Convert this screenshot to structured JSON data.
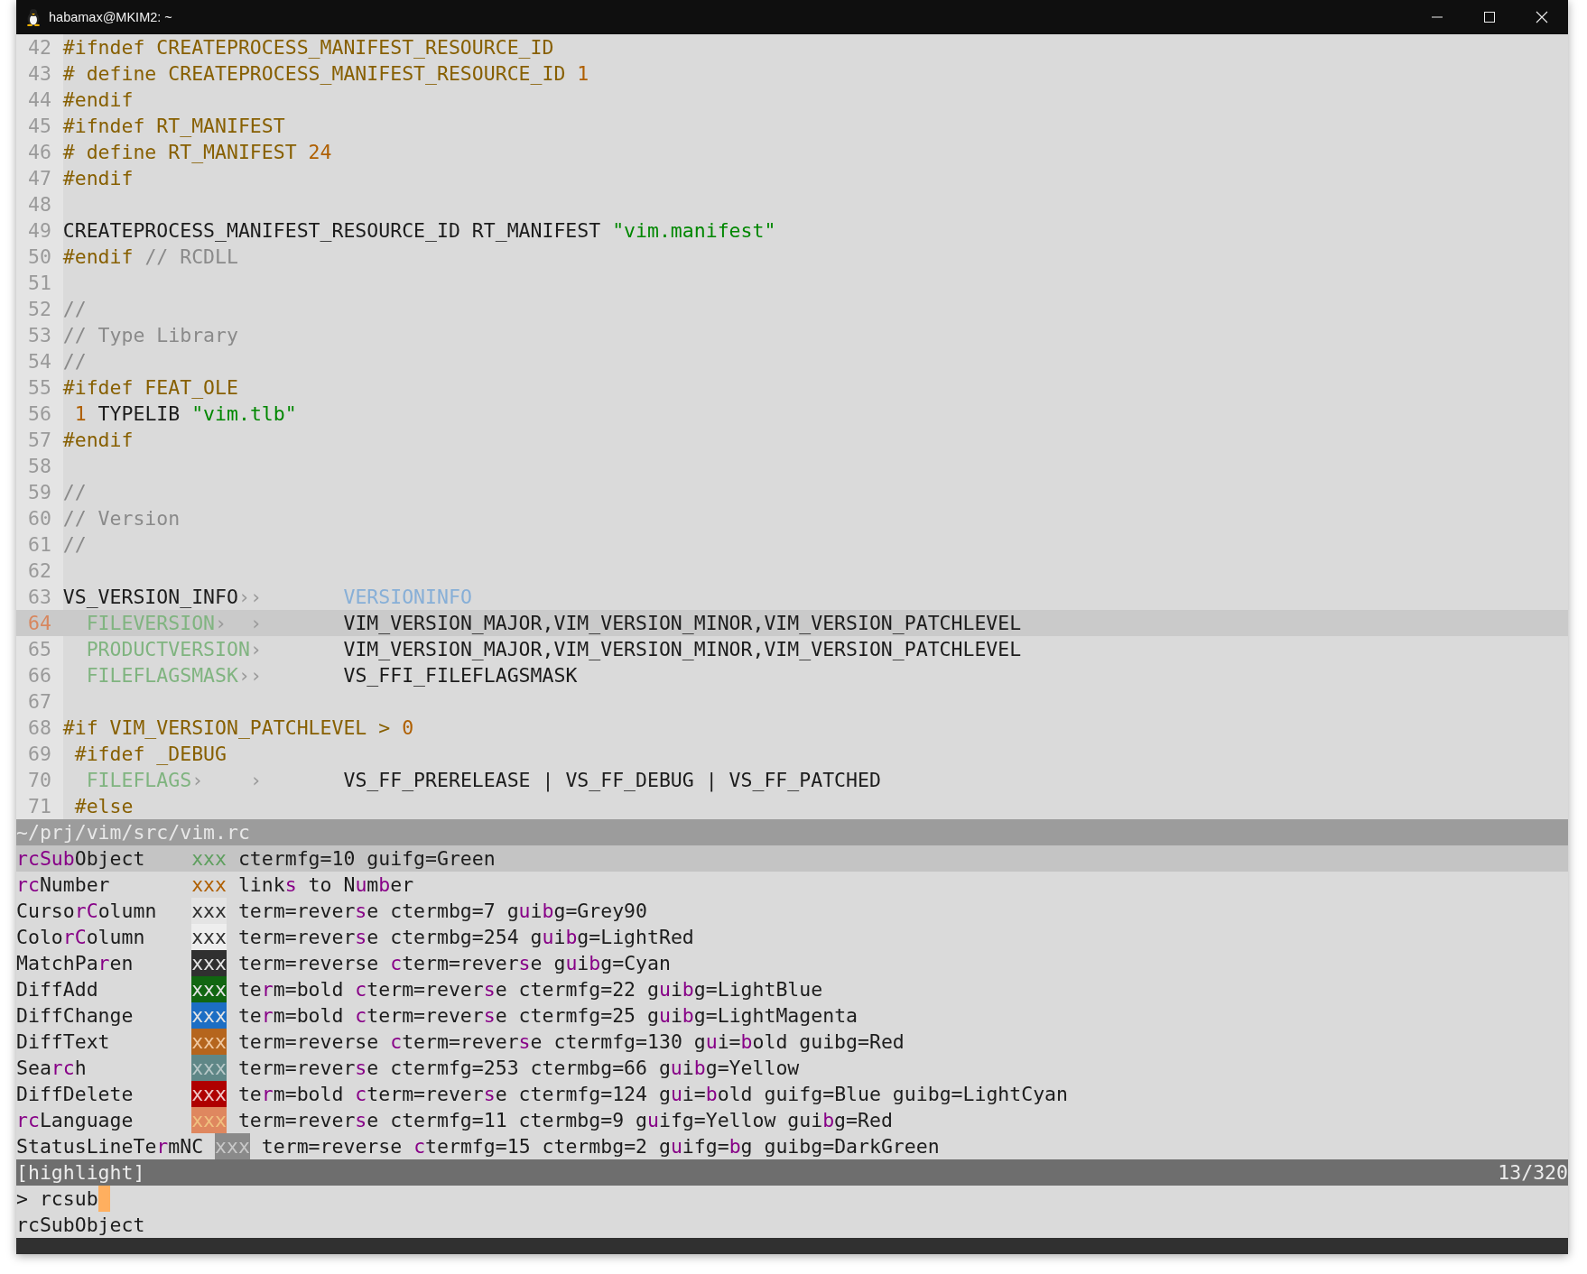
{
  "window": {
    "title": "habamax@MKIM2: ~"
  },
  "editor": {
    "lines": [
      {
        "number": "42",
        "current": false,
        "tokens": [
          {
            "text": "#ifndef CREATEPROCESS_MANIFEST_RESOURCE_ID",
            "kind": "keyword"
          }
        ]
      },
      {
        "number": "43",
        "current": false,
        "tokens": [
          {
            "text": "# define CREATEPROCESS_MANIFEST_RESOURCE_ID ",
            "kind": "keyword"
          },
          {
            "text": "1",
            "kind": "number"
          }
        ]
      },
      {
        "number": "44",
        "current": false,
        "tokens": [
          {
            "text": "#endif",
            "kind": "keyword"
          }
        ]
      },
      {
        "number": "45",
        "current": false,
        "tokens": [
          {
            "text": "#ifndef RT_MANIFEST",
            "kind": "keyword"
          }
        ]
      },
      {
        "number": "46",
        "current": false,
        "tokens": [
          {
            "text": "# define RT_MANIFEST ",
            "kind": "keyword"
          },
          {
            "text": "24",
            "kind": "number"
          }
        ]
      },
      {
        "number": "47",
        "current": false,
        "tokens": [
          {
            "text": "#endif",
            "kind": "keyword"
          }
        ]
      },
      {
        "number": "48",
        "current": false
      },
      {
        "number": "49",
        "current": false,
        "tokens": [
          {
            "text": "CREATEPROCESS_MANIFEST_RESOURCE_ID RT_MANIFEST ",
            "kind": "normal"
          },
          {
            "text": "\"vim.manifest\"",
            "kind": "string"
          }
        ]
      },
      {
        "number": "50",
        "current": false,
        "tokens": [
          {
            "text": "#endif ",
            "kind": "keyword"
          },
          {
            "text": "// RCDLL",
            "kind": "comment"
          }
        ]
      },
      {
        "number": "51",
        "current": false
      },
      {
        "number": "52",
        "current": false,
        "tokens": [
          {
            "text": "//",
            "kind": "comment"
          }
        ]
      },
      {
        "number": "53",
        "current": false,
        "tokens": [
          {
            "text": "// Type Library",
            "kind": "comment"
          }
        ]
      },
      {
        "number": "54",
        "current": false,
        "tokens": [
          {
            "text": "//",
            "kind": "comment"
          }
        ]
      },
      {
        "number": "55",
        "current": false,
        "tokens": [
          {
            "text": "#ifdef FEAT_OLE",
            "kind": "keyword"
          }
        ]
      },
      {
        "number": "56",
        "current": false,
        "tokens": [
          {
            "text": " 1",
            "kind": "number"
          },
          {
            "text": " TYPELIB ",
            "kind": "normal"
          },
          {
            "text": "\"vim.tlb\"",
            "kind": "string"
          }
        ]
      },
      {
        "number": "57",
        "current": false,
        "tokens": [
          {
            "text": "#endif",
            "kind": "keyword"
          }
        ]
      },
      {
        "number": "58",
        "current": false
      },
      {
        "number": "59",
        "current": false,
        "tokens": [
          {
            "text": "//",
            "kind": "comment"
          }
        ]
      },
      {
        "number": "60",
        "current": false,
        "tokens": [
          {
            "text": "// Version",
            "kind": "comment"
          }
        ]
      },
      {
        "number": "61",
        "current": false,
        "tokens": [
          {
            "text": "//",
            "kind": "comment"
          }
        ]
      },
      {
        "number": "62",
        "current": false
      },
      {
        "number": "63",
        "current": false,
        "tokens": [
          {
            "text": "VS_VERSION_INFO",
            "kind": "normal"
          },
          {
            "text": "››       ",
            "kind": "tab"
          },
          {
            "text": "VERSIONINFO",
            "kind": "tag"
          }
        ]
      },
      {
        "number": "64",
        "current": true,
        "tokens": [
          {
            "text": "  FILEVERSION",
            "kind": "faint"
          },
          {
            "text": "›  ›       ",
            "kind": "tab"
          },
          {
            "text": "VIM_VERSION_MAJOR,VIM_VERSION_MINOR,VIM_VERSION_PATCHLEVEL",
            "kind": "normal"
          }
        ]
      },
      {
        "number": "65",
        "current": false,
        "tokens": [
          {
            "text": "  PRODUCTVERSION",
            "kind": "faint"
          },
          {
            "text": "›       ",
            "kind": "tab"
          },
          {
            "text": "VIM_VERSION_MAJOR,VIM_VERSION_MINOR,VIM_VERSION_PATCHLEVEL",
            "kind": "normal"
          }
        ]
      },
      {
        "number": "66",
        "current": false,
        "tokens": [
          {
            "text": "  FILEFLAGSMASK",
            "kind": "faint"
          },
          {
            "text": "››       ",
            "kind": "tab"
          },
          {
            "text": "VS_FFI_FILEFLAGSMASK",
            "kind": "normal"
          }
        ]
      },
      {
        "number": "67",
        "current": false
      },
      {
        "number": "68",
        "current": false,
        "tokens": [
          {
            "text": "#if VIM_VERSION_PATCHLEVEL > ",
            "kind": "keyword"
          },
          {
            "text": "0",
            "kind": "number"
          }
        ]
      },
      {
        "number": "69",
        "current": false,
        "tokens": [
          {
            "text": " #ifdef _DEBUG",
            "kind": "keyword"
          }
        ]
      },
      {
        "number": "70",
        "current": false,
        "tokens": [
          {
            "text": "  FILEFLAGS",
            "kind": "faint"
          },
          {
            "text": "›    ›       ",
            "kind": "tab"
          },
          {
            "text": "VS_FF_PRERELEASE | VS_FF_DEBUG | VS_FF_PATCHED",
            "kind": "normal"
          }
        ]
      },
      {
        "number": "71",
        "current": false,
        "tokens": [
          {
            "text": " #else",
            "kind": "keyword"
          }
        ]
      }
    ],
    "status_line": "~/prj/vim/src/vim.rc"
  },
  "highlight_list": {
    "groups": [
      {
        "selected": true,
        "name": [
          {
            "text": "rcSub",
            "match": true
          },
          {
            "text": "Object",
            "match": false
          }
        ],
        "swatch": {
          "text": "xxx",
          "color": "#5f9f5f"
        },
        "definition": [
          {
            "text": "ctermfg=10 guifg=Green",
            "match": false
          }
        ]
      },
      {
        "selected": false,
        "name": [
          {
            "text": "rc",
            "match": true
          },
          {
            "text": "Number",
            "match": false
          }
        ],
        "swatch": {
          "text": "xxx",
          "color": "#af5f00"
        },
        "definition": [
          {
            "text": "link",
            "match": false
          },
          {
            "text": "s",
            "match": true
          },
          {
            "text": " to N",
            "match": false
          },
          {
            "text": "u",
            "match": true
          },
          {
            "text": "m",
            "match": false
          },
          {
            "text": "b",
            "match": true
          },
          {
            "text": "er",
            "match": false
          }
        ]
      },
      {
        "selected": false,
        "name": [
          {
            "text": "Curso",
            "match": false
          },
          {
            "text": "rC",
            "match": true
          },
          {
            "text": "olumn",
            "match": false
          }
        ],
        "swatch": {
          "text": "xxx",
          "color": "#303030",
          "fill": {
            "color": "#e4e4e4"
          }
        },
        "definition": [
          {
            "text": "term=rever",
            "match": false
          },
          {
            "text": "s",
            "match": true
          },
          {
            "text": "e ctermbg=7 g",
            "match": false
          },
          {
            "text": "u",
            "match": true
          },
          {
            "text": "i",
            "match": false
          },
          {
            "text": "b",
            "match": true
          },
          {
            "text": "g=Grey90",
            "match": false
          }
        ]
      },
      {
        "selected": false,
        "name": [
          {
            "text": "Colo",
            "match": false
          },
          {
            "text": "rC",
            "match": true
          },
          {
            "text": "olumn",
            "match": false
          }
        ],
        "swatch": {
          "text": "xxx",
          "color": "#303030",
          "fill": {
            "color": "#eeeeee"
          }
        },
        "definition": [
          {
            "text": "term=rever",
            "match": false
          },
          {
            "text": "s",
            "match": true
          },
          {
            "text": "e ctermbg=254 g",
            "match": false
          },
          {
            "text": "u",
            "match": true
          },
          {
            "text": "i",
            "match": false
          },
          {
            "text": "b",
            "match": true
          },
          {
            "text": "g=LightRed",
            "match": false
          }
        ]
      },
      {
        "selected": false,
        "name": [
          {
            "text": "MatchPa",
            "match": false
          },
          {
            "text": "r",
            "match": true
          },
          {
            "text": "en",
            "match": false
          }
        ],
        "swatch": {
          "text": "xxx",
          "color": "#e4e4e4",
          "fill": {
            "color": "#303030"
          }
        },
        "definition": [
          {
            "text": "term=reverse ",
            "match": false
          },
          {
            "text": "c",
            "match": true
          },
          {
            "text": "term=rever",
            "match": false
          },
          {
            "text": "s",
            "match": true
          },
          {
            "text": "e g",
            "match": false
          },
          {
            "text": "u",
            "match": true
          },
          {
            "text": "i",
            "match": false
          },
          {
            "text": "b",
            "match": true
          },
          {
            "text": "g=Cyan",
            "match": false
          }
        ]
      },
      {
        "selected": false,
        "name": [
          {
            "text": "DiffAdd",
            "match": false
          }
        ],
        "swatch": {
          "text": "xxx",
          "color": "#e4e4e4",
          "fill": {
            "color": "#116611"
          }
        },
        "definition": [
          {
            "text": "te",
            "match": false
          },
          {
            "text": "r",
            "match": true
          },
          {
            "text": "m=bold ",
            "match": false
          },
          {
            "text": "c",
            "match": true
          },
          {
            "text": "term=rever",
            "match": false
          },
          {
            "text": "s",
            "match": true
          },
          {
            "text": "e ctermfg=22 g",
            "match": false
          },
          {
            "text": "u",
            "match": true
          },
          {
            "text": "i",
            "match": false
          },
          {
            "text": "b",
            "match": true
          },
          {
            "text": "g=LightBlue",
            "match": false
          }
        ]
      },
      {
        "selected": false,
        "name": [
          {
            "text": "DiffChange",
            "match": false
          }
        ],
        "swatch": {
          "text": "xxx",
          "color": "#e4e4e4",
          "fill": {
            "color": "#1c6ec4"
          }
        },
        "definition": [
          {
            "text": "te",
            "match": false
          },
          {
            "text": "r",
            "match": true
          },
          {
            "text": "m=bold ",
            "match": false
          },
          {
            "text": "c",
            "match": true
          },
          {
            "text": "term=rever",
            "match": false
          },
          {
            "text": "s",
            "match": true
          },
          {
            "text": "e ctermfg=25 g",
            "match": false
          },
          {
            "text": "u",
            "match": true
          },
          {
            "text": "i",
            "match": false
          },
          {
            "text": "b",
            "match": true
          },
          {
            "text": "g=LightMagenta",
            "match": false
          }
        ]
      },
      {
        "selected": false,
        "name": [
          {
            "text": "DiffText",
            "match": false
          }
        ],
        "swatch": {
          "text": "xxx",
          "color": "#f0c8a0",
          "fill": {
            "color": "#b5651d"
          }
        },
        "definition": [
          {
            "text": "term=reverse ",
            "match": false
          },
          {
            "text": "c",
            "match": true
          },
          {
            "text": "term=rever",
            "match": false
          },
          {
            "text": "s",
            "match": true
          },
          {
            "text": "e ctermfg=130 g",
            "match": false
          },
          {
            "text": "u",
            "match": true
          },
          {
            "text": "i=",
            "match": false
          },
          {
            "text": "b",
            "match": true
          },
          {
            "text": "old guibg=Red",
            "match": false
          }
        ]
      },
      {
        "selected": false,
        "name": [
          {
            "text": "Sea",
            "match": false
          },
          {
            "text": "rc",
            "match": true
          },
          {
            "text": "h",
            "match": false
          }
        ],
        "swatch": {
          "text": "xxx",
          "color": "#b8c8c8",
          "fill": {
            "color": "#5f8787"
          }
        },
        "definition": [
          {
            "text": "term=rever",
            "match": false
          },
          {
            "text": "s",
            "match": true
          },
          {
            "text": "e ctermfg=253 ctermbg=66 g",
            "match": false
          },
          {
            "text": "u",
            "match": true
          },
          {
            "text": "i",
            "match": false
          },
          {
            "text": "b",
            "match": true
          },
          {
            "text": "g=Yellow",
            "match": false
          }
        ]
      },
      {
        "selected": false,
        "name": [
          {
            "text": "DiffDelete",
            "match": false
          }
        ],
        "swatch": {
          "text": "xxx",
          "color": "#f0c8c8",
          "fill": {
            "color": "#af0000"
          }
        },
        "definition": [
          {
            "text": "te",
            "match": false
          },
          {
            "text": "r",
            "match": true
          },
          {
            "text": "m=bold ",
            "match": false
          },
          {
            "text": "c",
            "match": true
          },
          {
            "text": "term=rever",
            "match": false
          },
          {
            "text": "s",
            "match": true
          },
          {
            "text": "e ctermfg=124 g",
            "match": false
          },
          {
            "text": "u",
            "match": true
          },
          {
            "text": "i=",
            "match": false
          },
          {
            "text": "b",
            "match": true
          },
          {
            "text": "old guifg=Blue guibg=LightCyan",
            "match": false
          }
        ]
      },
      {
        "selected": false,
        "name": [
          {
            "text": "rc",
            "match": true
          },
          {
            "text": "Language",
            "match": false
          }
        ],
        "swatch": {
          "text": "xxx",
          "color": "#f0c080",
          "fill": {
            "color": "#df875f"
          }
        },
        "definition": [
          {
            "text": "term=rever",
            "match": false
          },
          {
            "text": "s",
            "match": true
          },
          {
            "text": "e ctermfg=11 ctermbg=9 g",
            "match": false
          },
          {
            "text": "u",
            "match": true
          },
          {
            "text": "ifg=Yellow gui",
            "match": false
          },
          {
            "text": "b",
            "match": true
          },
          {
            "text": "g=Red",
            "match": false
          }
        ]
      },
      {
        "selected": false,
        "name": [
          {
            "text": "StatusLineTe",
            "match": false
          },
          {
            "text": "r",
            "match": true
          },
          {
            "text": "mNC",
            "match": false
          }
        ],
        "swatch": {
          "text": "xxx",
          "color": "#c8c8c8",
          "fill": {
            "color": "#8a8a8a"
          }
        },
        "definition": [
          {
            "text": "term=reverse ",
            "match": false
          },
          {
            "text": "c",
            "match": true
          },
          {
            "text": "termfg=15 ctermbg=2 g",
            "match": false
          },
          {
            "text": "u",
            "match": true
          },
          {
            "text": "ifg=",
            "match": false
          },
          {
            "text": "b",
            "match": true
          },
          {
            "text": "g guibg=DarkGreen",
            "match": false
          }
        ]
      }
    ],
    "status": {
      "label": "[highlight]",
      "count": "13/320"
    },
    "prompt": {
      "symbol": ">",
      "value": "rcsub"
    },
    "result": "rcSubObject"
  }
}
